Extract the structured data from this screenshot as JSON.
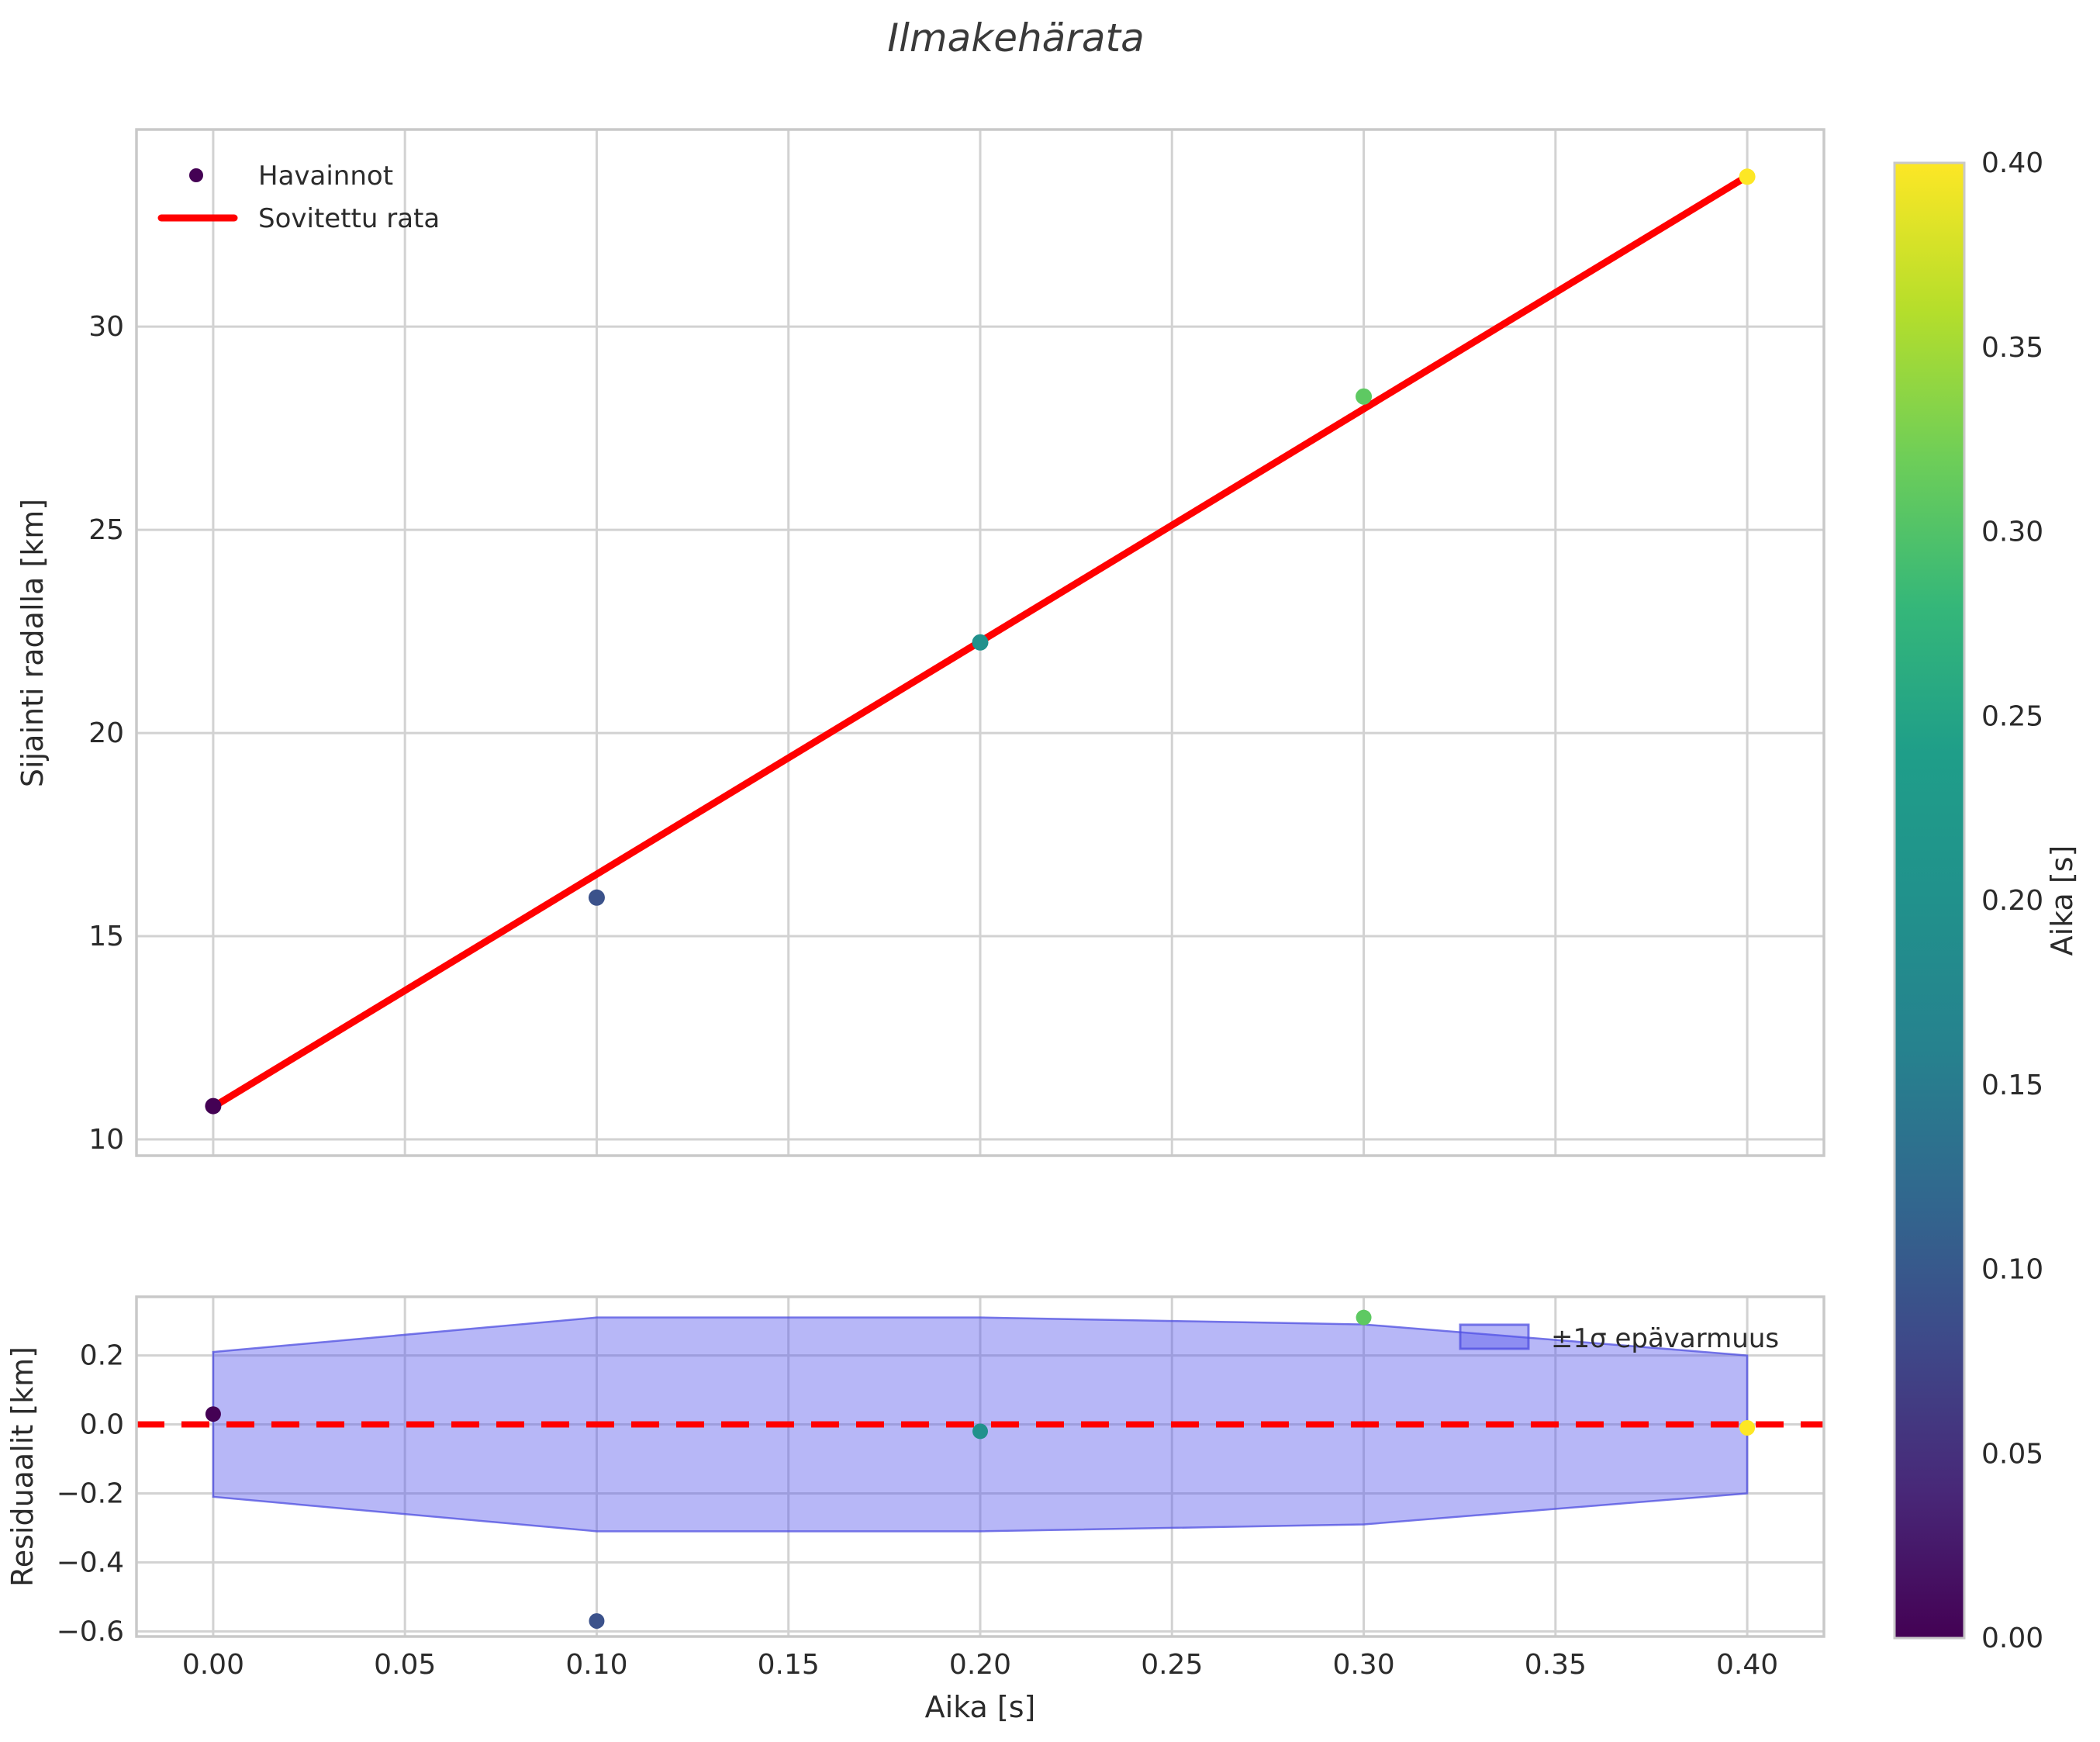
{
  "title": "Ilmakehärata",
  "chart_data": [
    {
      "id": "trajectory",
      "type": "scatter",
      "title": "Ilmakehärata",
      "xlabel": "",
      "ylabel": "Sijainti radalla [km]",
      "xlim": [
        -0.02,
        0.42
      ],
      "ylim": [
        9.6,
        34.85
      ],
      "grid": true,
      "xtick_values": [
        0.0,
        0.05,
        0.1,
        0.15,
        0.2,
        0.25,
        0.3,
        0.35,
        0.4
      ],
      "xtick_labels_shown": false,
      "ytick_values": [
        10,
        15,
        20,
        25,
        30
      ],
      "ytick_labels": [
        "10",
        "15",
        "20",
        "25",
        "30"
      ],
      "legend": {
        "position": "upper-left",
        "items": [
          {
            "label": "Havainnot",
            "marker": "dot",
            "color": "#440154"
          },
          {
            "label": "Sovitettu rata",
            "marker": "line",
            "color": "#ff0000"
          }
        ]
      },
      "series": [
        {
          "name": "Havainnot",
          "type": "scatter",
          "x": [
            0.0,
            0.1,
            0.2,
            0.3,
            0.4
          ],
          "y": [
            10.82,
            15.95,
            22.23,
            28.28,
            33.69
          ],
          "colormap": "viridis",
          "color_values": [
            0.0,
            0.1,
            0.2,
            0.3,
            0.4
          ],
          "point_colors": [
            "#440154",
            "#3b528b",
            "#21918c",
            "#5ec962",
            "#fde725"
          ]
        },
        {
          "name": "Sovitettu rata",
          "type": "line",
          "x": [
            0.0,
            0.4
          ],
          "y": [
            10.8,
            33.7
          ],
          "color": "#ff0000",
          "width": 9
        }
      ]
    },
    {
      "id": "residuals",
      "type": "scatter",
      "xlabel": "Aika [s]",
      "ylabel": "Residuaalit [km]",
      "xlim": [
        -0.02,
        0.42
      ],
      "ylim": [
        -0.615,
        0.37
      ],
      "grid": true,
      "xtick_values": [
        0.0,
        0.05,
        0.1,
        0.15,
        0.2,
        0.25,
        0.3,
        0.35,
        0.4
      ],
      "xtick_labels": [
        "0.00",
        "0.05",
        "0.10",
        "0.15",
        "0.20",
        "0.25",
        "0.30",
        "0.35",
        "0.40"
      ],
      "ytick_values": [
        0.2,
        0.0,
        -0.2,
        -0.4,
        -0.6
      ],
      "ytick_labels": [
        "0.2",
        "0.0",
        "−0.2",
        "−0.4",
        "−0.6"
      ],
      "zero_line": {
        "y": 0,
        "color": "#ff0000",
        "style": "dashed",
        "width": 8,
        "dash": [
          36,
          22
        ]
      },
      "band": {
        "label": "±1σ epävarmuus",
        "x": [
          0.0,
          0.1,
          0.2,
          0.3,
          0.4
        ],
        "upper": [
          0.21,
          0.31,
          0.31,
          0.29,
          0.2
        ],
        "lower": [
          -0.21,
          -0.31,
          -0.31,
          -0.29,
          -0.2
        ],
        "fill": "rgba(84,84,235,0.42)",
        "edge": "rgba(78,78,224,0.75)"
      },
      "points": {
        "x": [
          0.0,
          0.1,
          0.2,
          0.3,
          0.4
        ],
        "y": [
          0.03,
          -0.57,
          -0.02,
          0.31,
          -0.01
        ],
        "colors": [
          "#440154",
          "#3b528b",
          "#21918c",
          "#5ec962",
          "#fde725"
        ]
      }
    }
  ],
  "colorbar": {
    "label": "Aika [s]",
    "min": 0.0,
    "max": 0.4,
    "colormap": "viridis",
    "tick_values": [
      0.0,
      0.05,
      0.1,
      0.15,
      0.2,
      0.25,
      0.3,
      0.35,
      0.4
    ],
    "tick_labels": [
      "0.00",
      "0.05",
      "0.10",
      "0.15",
      "0.20",
      "0.25",
      "0.30",
      "0.35",
      "0.40"
    ],
    "stops": [
      {
        "offset": 0.0,
        "color": "#440154"
      },
      {
        "offset": 0.1,
        "color": "#482878"
      },
      {
        "offset": 0.2,
        "color": "#3e4989"
      },
      {
        "offset": 0.3,
        "color": "#31688e"
      },
      {
        "offset": 0.4,
        "color": "#26828e"
      },
      {
        "offset": 0.5,
        "color": "#21918c"
      },
      {
        "offset": 0.6,
        "color": "#1f9e89"
      },
      {
        "offset": 0.7,
        "color": "#35b779"
      },
      {
        "offset": 0.8,
        "color": "#6ece58"
      },
      {
        "offset": 0.9,
        "color": "#b5de2b"
      },
      {
        "offset": 1.0,
        "color": "#fde725"
      }
    ]
  }
}
